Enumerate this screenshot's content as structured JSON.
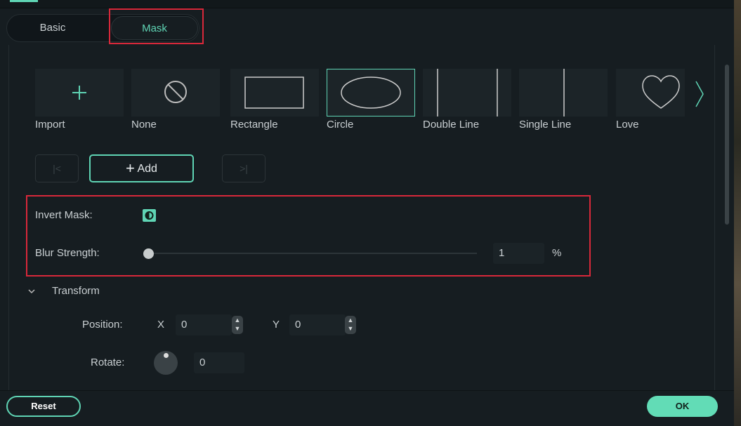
{
  "tabs": [
    {
      "label": "Basic",
      "active": false
    },
    {
      "label": "Mask",
      "active": true
    }
  ],
  "masks": [
    {
      "label": "Import",
      "icon": "plus-icon"
    },
    {
      "label": "None",
      "icon": "none-icon"
    },
    {
      "label": "Rectangle",
      "icon": "rectangle-icon"
    },
    {
      "label": "Circle",
      "icon": "circle-icon",
      "selected": true
    },
    {
      "label": "Double Line",
      "icon": "double-line-icon"
    },
    {
      "label": "Single Line",
      "icon": "single-line-icon"
    },
    {
      "label": "Love",
      "icon": "heart-icon"
    }
  ],
  "keyframe": {
    "add_label": "Add"
  },
  "invert_mask": {
    "label": "Invert Mask:",
    "enabled": true
  },
  "blur": {
    "label": "Blur Strength:",
    "value": "1",
    "unit": "%",
    "percent": 1
  },
  "transform": {
    "title": "Transform",
    "position_label": "Position:",
    "x_label": "X",
    "x_value": "0",
    "y_label": "Y",
    "y_value": "0",
    "rotate_label": "Rotate:",
    "rotate_value": "0"
  },
  "footer": {
    "reset": "Reset",
    "ok": "OK"
  },
  "colors": {
    "accent": "#5fd4b4",
    "highlight": "#d8283a",
    "background": "#161d21"
  }
}
